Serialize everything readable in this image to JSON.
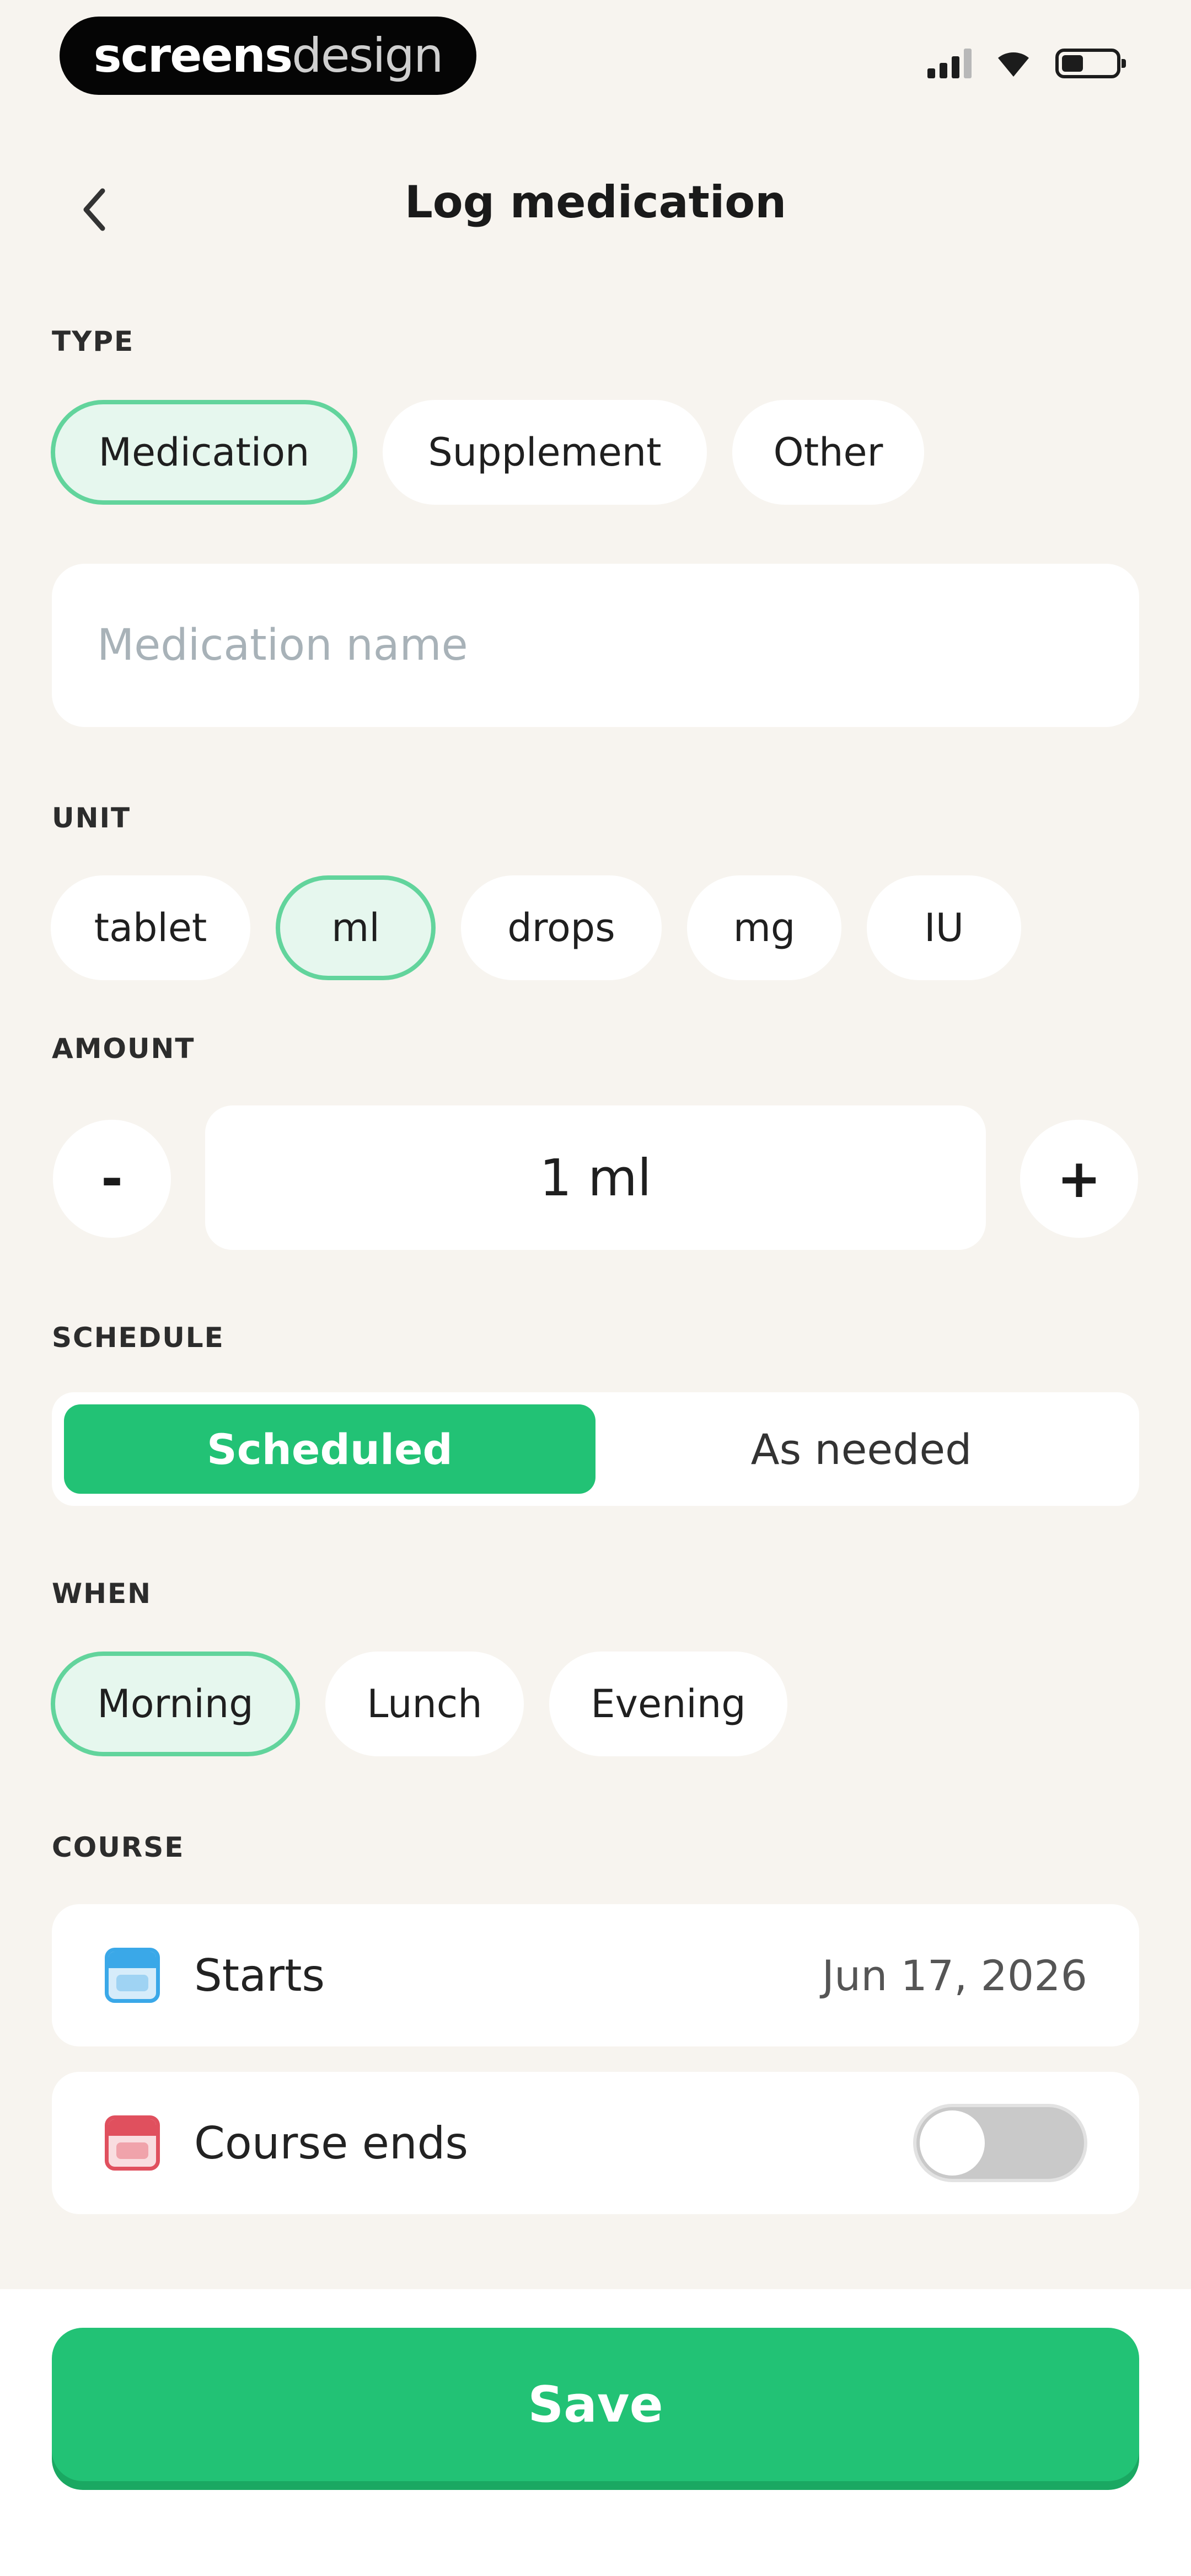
{
  "status_bar": {
    "brand_bold": "screens",
    "brand_light": "design"
  },
  "header": {
    "title": "Log medication",
    "back_icon": "chevron-left-icon"
  },
  "type": {
    "label": "TYPE",
    "options": [
      "Medication",
      "Supplement",
      "Other"
    ],
    "selected": "Medication"
  },
  "name_field": {
    "placeholder": "Medication name",
    "value": ""
  },
  "unit": {
    "label": "UNIT",
    "options": [
      "tablet",
      "ml",
      "drops",
      "mg",
      "IU"
    ],
    "selected": "ml"
  },
  "amount": {
    "label": "AMOUNT",
    "decrement": "-",
    "value": "1 ml",
    "increment": "+"
  },
  "schedule": {
    "label": "SCHEDULE",
    "options": [
      "Scheduled",
      "As needed"
    ],
    "selected": "Scheduled"
  },
  "when": {
    "label": "WHEN",
    "options": [
      "Morning",
      "Lunch",
      "Evening"
    ],
    "selected": "Morning"
  },
  "course": {
    "label": "COURSE",
    "starts_label": "Starts",
    "starts_value": "Jun 17, 2026",
    "starts_icon": "calendar-icon",
    "starts_icon_color": "#3aa8e8",
    "ends_label": "Course ends",
    "ends_icon": "calendar-icon",
    "ends_icon_color": "#e0505e",
    "ends_enabled": false
  },
  "save_button": "Save",
  "colors": {
    "accent": "#22c275",
    "selected_chip_bg": "#e6f7ee",
    "selected_chip_border": "#62d49c",
    "background": "#f7f4ef"
  }
}
